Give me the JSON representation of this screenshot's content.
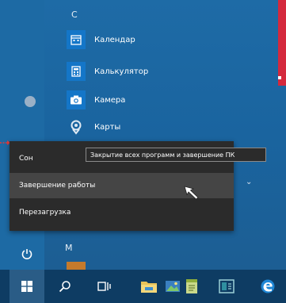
{
  "start_menu": {
    "section_letters": [
      "C",
      "М"
    ],
    "apps": [
      {
        "label": "Календар",
        "icon": "calendar-icon"
      },
      {
        "label": "Калькулятор",
        "icon": "calculator-icon"
      },
      {
        "label": "Камера",
        "icon": "camera-icon"
      },
      {
        "label": "Карты",
        "icon": "maps-icon"
      }
    ]
  },
  "power_menu": {
    "items": [
      {
        "label": "Сон"
      },
      {
        "label": "Завершение работы"
      },
      {
        "label": "Перезагрузка"
      }
    ],
    "tooltip": "Закрытие всех программ и завершение ПК"
  },
  "taskbar": {
    "icons": [
      "windows-start-icon",
      "search-icon",
      "task-view-icon",
      "file-explorer-icon",
      "photos-icon",
      "notepad-icon",
      "app-icon",
      "edge-icon"
    ]
  },
  "colors": {
    "start_bg": "#1e6ba6",
    "menu_bg": "#2b2b2b",
    "menu_highlight": "#454545",
    "taskbar_bg": "#0e3c63",
    "tile_blue": "#1476c8",
    "accent_red": "#d4293d"
  }
}
